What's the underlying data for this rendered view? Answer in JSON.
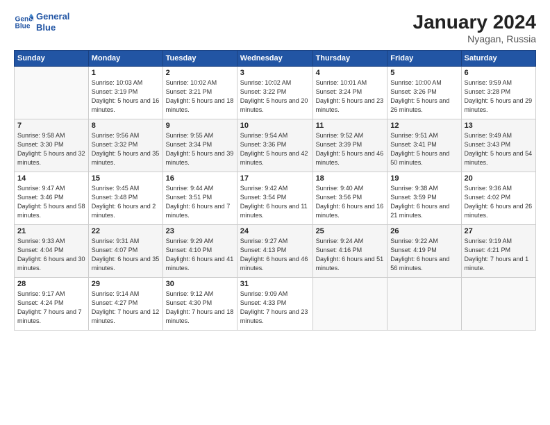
{
  "logo": {
    "line1": "General",
    "line2": "Blue"
  },
  "title": "January 2024",
  "location": "Nyagan, Russia",
  "days_header": [
    "Sunday",
    "Monday",
    "Tuesday",
    "Wednesday",
    "Thursday",
    "Friday",
    "Saturday"
  ],
  "weeks": [
    [
      {
        "day": "",
        "content": ""
      },
      {
        "day": "1",
        "content": "Sunrise: 10:03 AM\nSunset: 3:19 PM\nDaylight: 5 hours\nand 16 minutes."
      },
      {
        "day": "2",
        "content": "Sunrise: 10:02 AM\nSunset: 3:21 PM\nDaylight: 5 hours\nand 18 minutes."
      },
      {
        "day": "3",
        "content": "Sunrise: 10:02 AM\nSunset: 3:22 PM\nDaylight: 5 hours\nand 20 minutes."
      },
      {
        "day": "4",
        "content": "Sunrise: 10:01 AM\nSunset: 3:24 PM\nDaylight: 5 hours\nand 23 minutes."
      },
      {
        "day": "5",
        "content": "Sunrise: 10:00 AM\nSunset: 3:26 PM\nDaylight: 5 hours\nand 26 minutes."
      },
      {
        "day": "6",
        "content": "Sunrise: 9:59 AM\nSunset: 3:28 PM\nDaylight: 5 hours\nand 29 minutes."
      }
    ],
    [
      {
        "day": "7",
        "content": "Sunrise: 9:58 AM\nSunset: 3:30 PM\nDaylight: 5 hours\nand 32 minutes."
      },
      {
        "day": "8",
        "content": "Sunrise: 9:56 AM\nSunset: 3:32 PM\nDaylight: 5 hours\nand 35 minutes."
      },
      {
        "day": "9",
        "content": "Sunrise: 9:55 AM\nSunset: 3:34 PM\nDaylight: 5 hours\nand 39 minutes."
      },
      {
        "day": "10",
        "content": "Sunrise: 9:54 AM\nSunset: 3:36 PM\nDaylight: 5 hours\nand 42 minutes."
      },
      {
        "day": "11",
        "content": "Sunrise: 9:52 AM\nSunset: 3:39 PM\nDaylight: 5 hours\nand 46 minutes."
      },
      {
        "day": "12",
        "content": "Sunrise: 9:51 AM\nSunset: 3:41 PM\nDaylight: 5 hours\nand 50 minutes."
      },
      {
        "day": "13",
        "content": "Sunrise: 9:49 AM\nSunset: 3:43 PM\nDaylight: 5 hours\nand 54 minutes."
      }
    ],
    [
      {
        "day": "14",
        "content": "Sunrise: 9:47 AM\nSunset: 3:46 PM\nDaylight: 5 hours\nand 58 minutes."
      },
      {
        "day": "15",
        "content": "Sunrise: 9:45 AM\nSunset: 3:48 PM\nDaylight: 6 hours\nand 2 minutes."
      },
      {
        "day": "16",
        "content": "Sunrise: 9:44 AM\nSunset: 3:51 PM\nDaylight: 6 hours\nand 7 minutes."
      },
      {
        "day": "17",
        "content": "Sunrise: 9:42 AM\nSunset: 3:54 PM\nDaylight: 6 hours\nand 11 minutes."
      },
      {
        "day": "18",
        "content": "Sunrise: 9:40 AM\nSunset: 3:56 PM\nDaylight: 6 hours\nand 16 minutes."
      },
      {
        "day": "19",
        "content": "Sunrise: 9:38 AM\nSunset: 3:59 PM\nDaylight: 6 hours\nand 21 minutes."
      },
      {
        "day": "20",
        "content": "Sunrise: 9:36 AM\nSunset: 4:02 PM\nDaylight: 6 hours\nand 26 minutes."
      }
    ],
    [
      {
        "day": "21",
        "content": "Sunrise: 9:33 AM\nSunset: 4:04 PM\nDaylight: 6 hours\nand 30 minutes."
      },
      {
        "day": "22",
        "content": "Sunrise: 9:31 AM\nSunset: 4:07 PM\nDaylight: 6 hours\nand 35 minutes."
      },
      {
        "day": "23",
        "content": "Sunrise: 9:29 AM\nSunset: 4:10 PM\nDaylight: 6 hours\nand 41 minutes."
      },
      {
        "day": "24",
        "content": "Sunrise: 9:27 AM\nSunset: 4:13 PM\nDaylight: 6 hours\nand 46 minutes."
      },
      {
        "day": "25",
        "content": "Sunrise: 9:24 AM\nSunset: 4:16 PM\nDaylight: 6 hours\nand 51 minutes."
      },
      {
        "day": "26",
        "content": "Sunrise: 9:22 AM\nSunset: 4:19 PM\nDaylight: 6 hours\nand 56 minutes."
      },
      {
        "day": "27",
        "content": "Sunrise: 9:19 AM\nSunset: 4:21 PM\nDaylight: 7 hours\nand 1 minute."
      }
    ],
    [
      {
        "day": "28",
        "content": "Sunrise: 9:17 AM\nSunset: 4:24 PM\nDaylight: 7 hours\nand 7 minutes."
      },
      {
        "day": "29",
        "content": "Sunrise: 9:14 AM\nSunset: 4:27 PM\nDaylight: 7 hours\nand 12 minutes."
      },
      {
        "day": "30",
        "content": "Sunrise: 9:12 AM\nSunset: 4:30 PM\nDaylight: 7 hours\nand 18 minutes."
      },
      {
        "day": "31",
        "content": "Sunrise: 9:09 AM\nSunset: 4:33 PM\nDaylight: 7 hours\nand 23 minutes."
      },
      {
        "day": "",
        "content": ""
      },
      {
        "day": "",
        "content": ""
      },
      {
        "day": "",
        "content": ""
      }
    ]
  ]
}
